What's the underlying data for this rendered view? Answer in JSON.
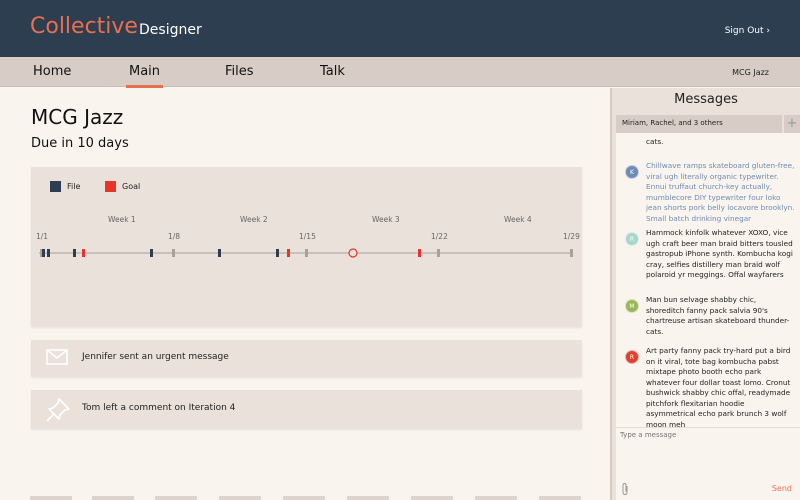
{
  "header": {
    "brand": "Collective",
    "role": "Designer",
    "sign_out": "Sign Out ›"
  },
  "nav": {
    "items": [
      {
        "label": "Home"
      },
      {
        "label": "Main"
      },
      {
        "label": "Files"
      },
      {
        "label": "Talk"
      }
    ],
    "active": "Main",
    "project": "MCG Jazz"
  },
  "project": {
    "title": "MCG Jazz",
    "due": "Due in 10 days"
  },
  "timeline": {
    "legend": [
      {
        "label": "File",
        "color": "#2c3e50"
      },
      {
        "label": "Goal",
        "color": "#e8342a"
      }
    ],
    "weeks": [
      "Week 1",
      "Week 2",
      "Week 3",
      "Week 4"
    ],
    "dates": [
      "1/1",
      "1/8",
      "1/15",
      "1/22",
      "1/29"
    ],
    "marker_colors": {
      "file": "#2c3e50",
      "goal": "#e8342a",
      "other": "#a9a29c",
      "today_ring": "#e8342a"
    }
  },
  "activity": [
    {
      "text": "Jennifer sent an urgent message",
      "icon": "envelope-icon"
    },
    {
      "text": "Tom left a comment on Iteration 4",
      "icon": "pushpin-icon"
    }
  ],
  "messages": {
    "title": "Messages",
    "thread": "Miriam, Rachel, and 3 others",
    "items": [
      {
        "initial": "",
        "color": "",
        "text": "chartreuse artisan skateboard thunder-cats."
      },
      {
        "initial": "K",
        "color": "#6d8cb5",
        "text": "Chillwave ramps skateboard gluten-free, viral ugh literally organic typewriter.  Ennui truffaut church-key actually, mumblecore DIY typewriter four loko jean shorts pork belly locavore brooklyn. Small batch drinking vinegar"
      },
      {
        "initial": "R",
        "color": "#a8d5cc",
        "text": "Hammock kinfolk whatever XOXO, vice ugh craft beer man braid bitters tousled gastropub iPhone synth. Kombucha kogi cray, selfies distillery man braid wolf polaroid yr meggings. Offal wayfarers"
      },
      {
        "initial": "M",
        "color": "#9ab65a",
        "text": "Man bun selvage shabby chic, shoreditch fanny pack salvia 90's chartreuse artisan skateboard thunder-cats."
      },
      {
        "initial": "R",
        "color": "#d9432f",
        "text": "Art party fanny pack try-hard put a bird on it viral, tote bag kombucha pabst mixtape photo booth echo park whatever four dollar toast lomo. Cronut bushwick shabby chic offal, readymade pitchfork flexitarian hoodie asymmetrical echo park brunch 3 wolf moon meh"
      }
    ],
    "compose_placeholder": "Type a message",
    "send": "Send"
  }
}
